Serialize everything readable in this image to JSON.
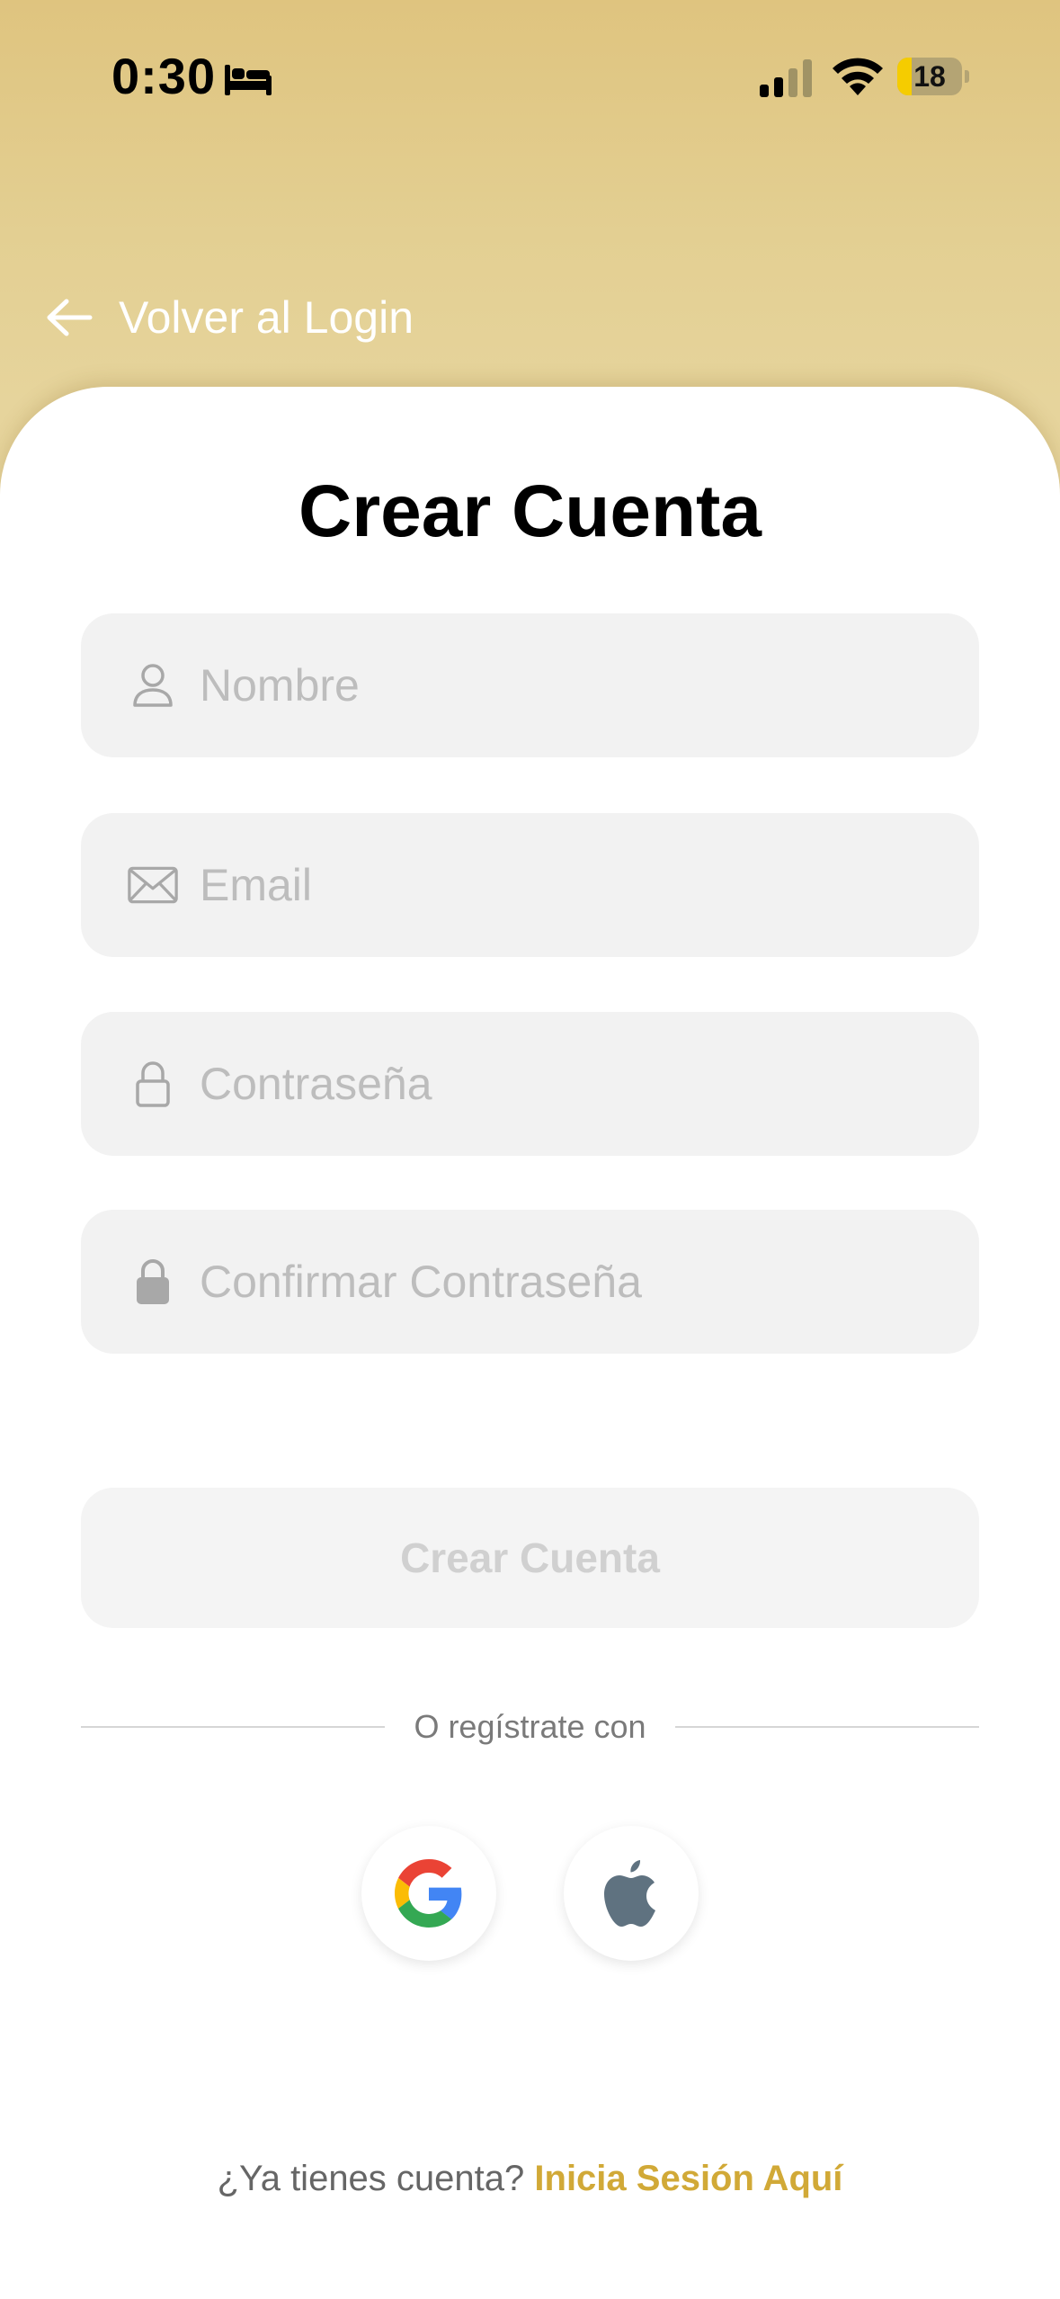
{
  "status_bar": {
    "time": "0:30",
    "focus_icon": "bed-icon",
    "battery_level": "18",
    "icons": [
      "cellular-signal-icon",
      "wifi-icon",
      "battery-icon"
    ]
  },
  "header": {
    "back_label": "Volver al Login",
    "back_icon": "arrow-left-icon"
  },
  "form": {
    "title": "Crear Cuenta",
    "fields": [
      {
        "placeholder": "Nombre",
        "value": "",
        "icon": "user-icon"
      },
      {
        "placeholder": "Email",
        "value": "",
        "icon": "envelope-icon"
      },
      {
        "placeholder": "Contraseña",
        "value": "",
        "icon": "lock-outline-icon"
      },
      {
        "placeholder": "Confirmar Contraseña",
        "value": "",
        "icon": "lock-filled-icon"
      }
    ],
    "submit_label": "Crear Cuenta",
    "submit_enabled": false
  },
  "social": {
    "divider_text": "O regístrate con",
    "providers": [
      {
        "name": "Google",
        "icon": "google-icon"
      },
      {
        "name": "Apple",
        "icon": "apple-icon"
      }
    ]
  },
  "footer": {
    "prompt": "¿Ya tienes cuenta?",
    "link_label": "Inicia Sesión Aquí"
  },
  "colors": {
    "header_gradient_top": "#dfc47f",
    "header_gradient_bottom": "#e6d49c",
    "accent": "#d1a937",
    "field_background": "#f2f2f2",
    "placeholder": "#bdbdbd"
  }
}
